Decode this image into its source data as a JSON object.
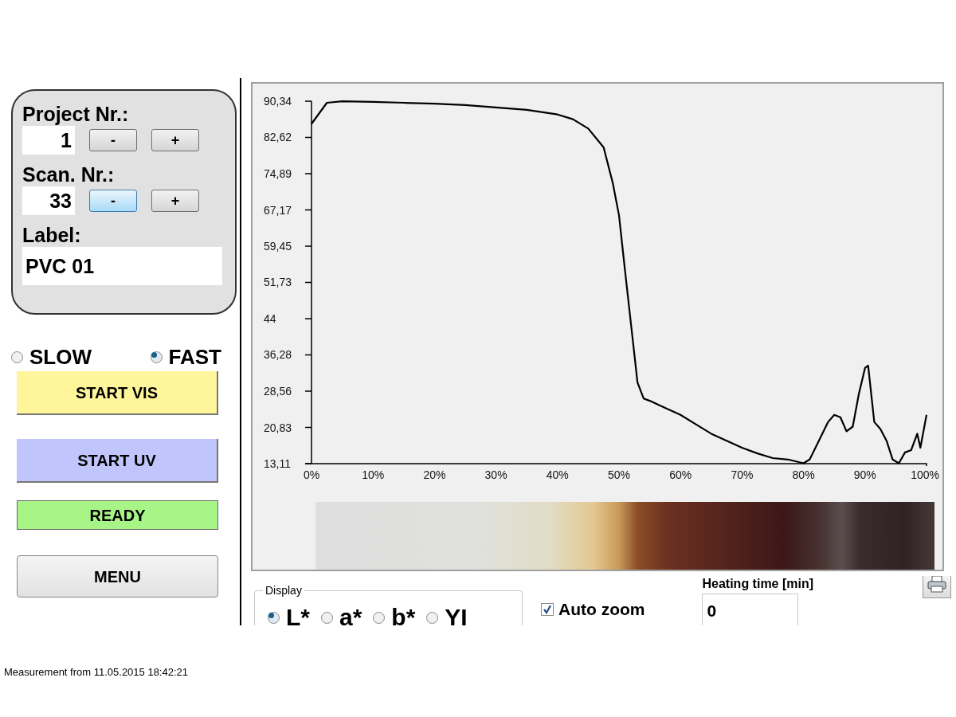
{
  "project": {
    "label": "Project Nr.:",
    "value": "1",
    "buttons": [
      {
        "label": "-",
        "highlighted": false
      },
      {
        "label": "+",
        "highlighted": false
      }
    ]
  },
  "scan": {
    "label": "Scan. Nr.:",
    "value": "33",
    "buttons": [
      {
        "label": "-",
        "highlighted": true
      },
      {
        "label": "+",
        "highlighted": false
      }
    ]
  },
  "label_field": {
    "label": "Label:",
    "value": "PVC 01"
  },
  "speed": [
    {
      "label": "SLOW",
      "selected": false
    },
    {
      "label": "FAST",
      "selected": true
    }
  ],
  "actions": [
    {
      "kind": "button",
      "label": "START VIS",
      "color": "#fff59a"
    },
    {
      "kind": "button",
      "label": "START UV",
      "color": "#c0c6fb"
    },
    {
      "kind": "status",
      "label": "READY",
      "color": "#a8f587"
    },
    {
      "kind": "menu",
      "label": "MENU",
      "color": "#e2e2e2"
    }
  ],
  "chart": {
    "chart_data": {
      "type": "line",
      "x": [
        0,
        2.5,
        5,
        10,
        15,
        20,
        25,
        30,
        35,
        40,
        42.5,
        45,
        47.5,
        49,
        50,
        51,
        52,
        53,
        54,
        55,
        57.5,
        60,
        62.5,
        65,
        67.5,
        70,
        72.5,
        75,
        77.5,
        80,
        81,
        82.5,
        84,
        85,
        86,
        87,
        88,
        89,
        90,
        90.5,
        91.5,
        92.5,
        93.5,
        94.5,
        95.5,
        96.5,
        97.5,
        98.5,
        99,
        100
      ],
      "series": [
        {
          "color": "#000000",
          "values": [
            85.5,
            90,
            90.3,
            90.2,
            90,
            89.8,
            89.5,
            89,
            88.5,
            87.5,
            86.5,
            84.5,
            80.5,
            72.8,
            66,
            54,
            42.3,
            30.4,
            27,
            26.5,
            25,
            23.5,
            21.5,
            19.5,
            18,
            16.5,
            15.3,
            14.3,
            14,
            13.2,
            14,
            18,
            22,
            23.5,
            23,
            20,
            21,
            28,
            33.5,
            34,
            22,
            20.5,
            18,
            14,
            13.2,
            15.5,
            16,
            19.5,
            16.5,
            23.5
          ]
        }
      ],
      "xlim": [
        0,
        100
      ],
      "ylim": [
        13.11,
        90.34
      ],
      "xticks": [
        {
          "value": 0,
          "label": "0%"
        },
        {
          "value": 10,
          "label": "10%"
        },
        {
          "value": 20,
          "label": "20%"
        },
        {
          "value": 30,
          "label": "30%"
        },
        {
          "value": 40,
          "label": "40%"
        },
        {
          "value": 50,
          "label": "50%"
        },
        {
          "value": 60,
          "label": "60%"
        },
        {
          "value": 70,
          "label": "70%"
        },
        {
          "value": 80,
          "label": "80%"
        },
        {
          "value": 90,
          "label": "90%"
        },
        {
          "value": 100,
          "label": "100%"
        }
      ],
      "yticks": [
        {
          "value": 13.11,
          "label": "13,11"
        },
        {
          "value": 20.83,
          "label": "20,83"
        },
        {
          "value": 28.56,
          "label": "28,56"
        },
        {
          "value": 36.28,
          "label": "36,28"
        },
        {
          "value": 44,
          "label": "44"
        },
        {
          "value": 51.73,
          "label": "51,73"
        },
        {
          "value": 59.45,
          "label": "59,45"
        },
        {
          "value": 67.17,
          "label": "67,17"
        },
        {
          "value": 74.89,
          "label": "74,89"
        },
        {
          "value": 82.62,
          "label": "82,62"
        },
        {
          "value": 90.34,
          "label": "90,34"
        }
      ]
    }
  },
  "display": {
    "title": "Display",
    "options": [
      {
        "label": "L*",
        "selected": true
      },
      {
        "label": "a*",
        "selected": false
      },
      {
        "label": "b*",
        "selected": false
      },
      {
        "label": "YI",
        "selected": false
      }
    ]
  },
  "auto_zoom": {
    "label": "Auto zoom",
    "checked": true
  },
  "heating_time": {
    "label": "Heating time [min]",
    "value": "0"
  },
  "footer": "Measurement from 11.05.2015 18:42:21"
}
